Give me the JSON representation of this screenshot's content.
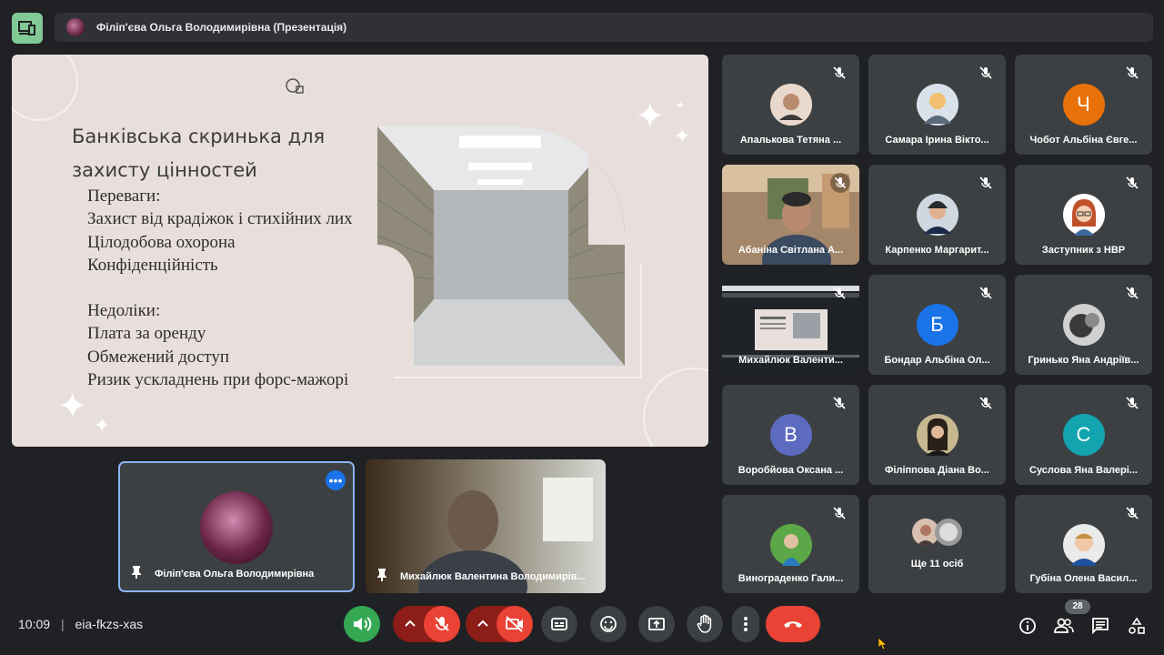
{
  "header": {
    "presenter_title": "Філіп'єва Ольга Володимирівна (Презентація)"
  },
  "slide": {
    "title_line1": "Банківська скринька для",
    "title_line2": "захисту цінностей",
    "lines": [
      "Переваги:",
      "Захист від крадіжок і стихійних лих",
      "Цілодобова охорона",
      "Конфіденційність",
      "Недоліки:",
      "Плата за оренду",
      "Обмежений доступ",
      "Ризик ускладнень при форс-мажорі"
    ]
  },
  "self_tiles": {
    "presenter_name": "Філіп'єва Ольга Володимирівна",
    "camera_name": "Михайлюк Валентина Володимирів..."
  },
  "participants": [
    {
      "name": "Апалькова Тетяна ...",
      "initial": "",
      "color": ""
    },
    {
      "name": "Самара Ірина Вікто...",
      "initial": "",
      "color": ""
    },
    {
      "name": "Чобот Альбіна Євге...",
      "initial": "Ч",
      "color": "#e8710a"
    },
    {
      "name": "Абаніна Світлана А...",
      "initial": "",
      "color": ""
    },
    {
      "name": "Карпенко Маргарит...",
      "initial": "",
      "color": ""
    },
    {
      "name": "Заступник з НВР",
      "initial": "",
      "color": ""
    },
    {
      "name": "Михайлюк Валенти...",
      "initial": "",
      "color": ""
    },
    {
      "name": "Бондар Альбіна Ол...",
      "initial": "Б",
      "color": "#1a73e8"
    },
    {
      "name": "Гринько Яна Андріїв...",
      "initial": "",
      "color": ""
    },
    {
      "name": "Воробйова Оксана ...",
      "initial": "В",
      "color": "#5c6bc0"
    },
    {
      "name": "Філіппова Діана Во...",
      "initial": "",
      "color": ""
    },
    {
      "name": "Суслова Яна Валері...",
      "initial": "С",
      "color": "#12a4af"
    },
    {
      "name": "Винограденко Гали...",
      "initial": "",
      "color": ""
    },
    {
      "name": "Ще 11 осіб",
      "initial": "",
      "color": ""
    },
    {
      "name": "Губіна Олена Васил...",
      "initial": "",
      "color": ""
    }
  ],
  "footer": {
    "time": "10:09",
    "separator": "|",
    "meeting_code": "eia-fkzs-xas",
    "people_count": "28"
  },
  "colors": {
    "background": "#202124",
    "tile": "#3c4043",
    "accent_green": "#81c995",
    "danger_red": "#ea4335"
  }
}
